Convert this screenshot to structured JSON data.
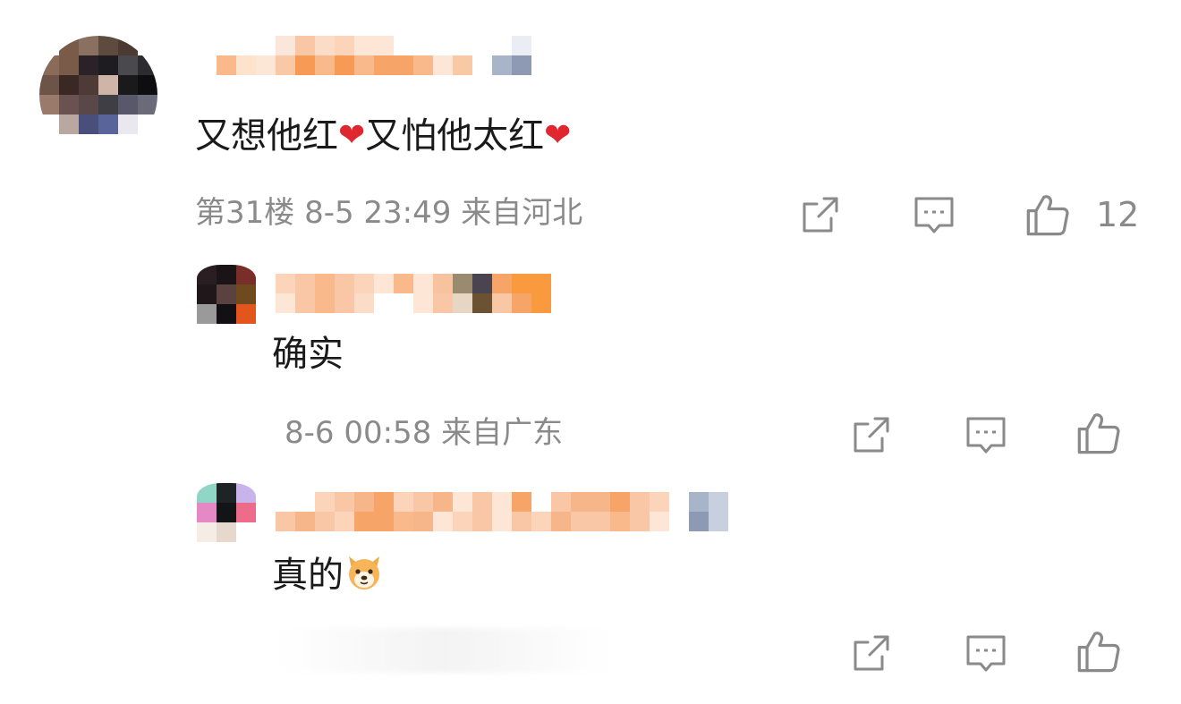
{
  "comments": [
    {
      "text_part1": "又想他红",
      "text_part2": "又怕他太红",
      "heart_icon": "red-heart-emoji",
      "meta": "第31楼 8-5 23:49 来自河北",
      "like_count": "12",
      "replies": [
        {
          "text": "确实",
          "meta": "8-6 00:58 来自广东"
        },
        {
          "text": "真的",
          "emoji": "dog-face-emoji",
          "meta": ""
        }
      ]
    }
  ],
  "icons": {
    "share": "share-icon",
    "reply": "comment-icon",
    "like": "thumbs-up-icon"
  },
  "colors": {
    "text": "#1a1a1a",
    "meta": "#8a8a8a",
    "heart": "#e0262e",
    "icon": "#8a8a8a"
  }
}
